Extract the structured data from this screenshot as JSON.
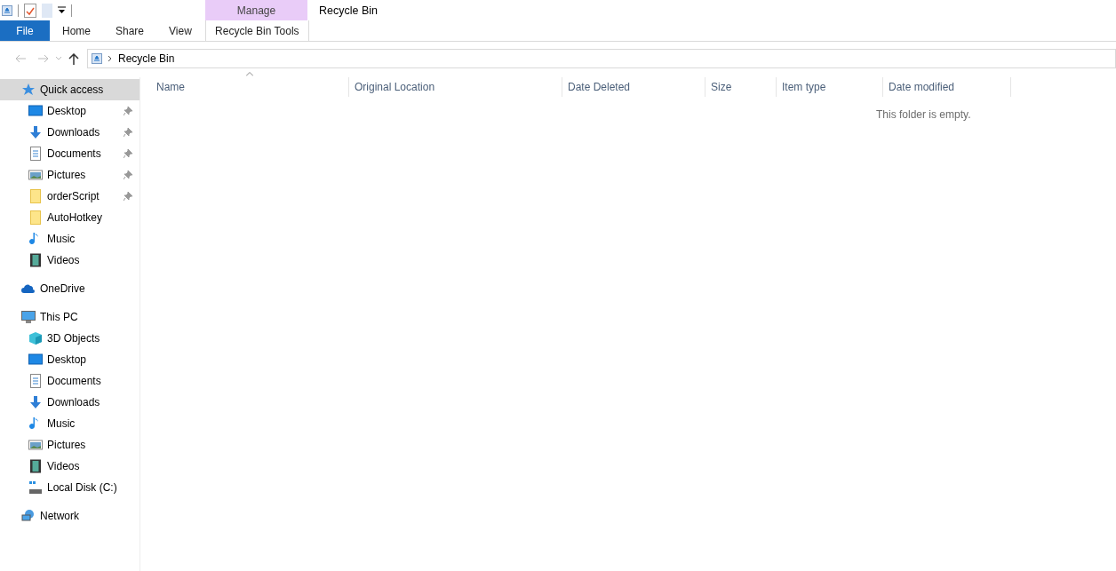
{
  "window": {
    "title": "Recycle Bin"
  },
  "context_group": "Manage",
  "ribbon_tabs": [
    {
      "label": "File",
      "kind": "file"
    },
    {
      "label": "Home",
      "kind": "tab"
    },
    {
      "label": "Share",
      "kind": "tab"
    },
    {
      "label": "View",
      "kind": "tab"
    },
    {
      "label": "Recycle Bin Tools",
      "kind": "context"
    }
  ],
  "address": {
    "path": "Recycle Bin"
  },
  "sidebar": {
    "items": [
      {
        "label": "Quick access",
        "kind": "star",
        "selected": true,
        "children": [
          {
            "label": "Desktop",
            "kind": "desktop",
            "pinned": true
          },
          {
            "label": "Downloads",
            "kind": "download",
            "pinned": true
          },
          {
            "label": "Documents",
            "kind": "document",
            "pinned": true
          },
          {
            "label": "Pictures",
            "kind": "picture",
            "pinned": true
          },
          {
            "label": "orderScript",
            "kind": "folder",
            "pinned": true
          },
          {
            "label": "AutoHotkey",
            "kind": "folder",
            "pinned": false
          },
          {
            "label": "Music",
            "kind": "music",
            "pinned": false
          },
          {
            "label": "Videos",
            "kind": "video",
            "pinned": false
          }
        ]
      },
      {
        "label": "OneDrive",
        "kind": "cloud",
        "selected": false
      },
      {
        "label": "This PC",
        "kind": "pc",
        "selected": false,
        "children": [
          {
            "label": "3D Objects",
            "kind": "cube",
            "pinned": false
          },
          {
            "label": "Desktop",
            "kind": "desktop",
            "pinned": false
          },
          {
            "label": "Documents",
            "kind": "document",
            "pinned": false
          },
          {
            "label": "Downloads",
            "kind": "download",
            "pinned": false
          },
          {
            "label": "Music",
            "kind": "music",
            "pinned": false
          },
          {
            "label": "Pictures",
            "kind": "picture",
            "pinned": false
          },
          {
            "label": "Videos",
            "kind": "video",
            "pinned": false
          },
          {
            "label": "Local Disk (C:)",
            "kind": "disk",
            "pinned": false
          }
        ]
      },
      {
        "label": "Network",
        "kind": "network",
        "selected": false
      }
    ]
  },
  "table": {
    "columns": [
      {
        "label": "Name",
        "sorted": true
      },
      {
        "label": "Original Location",
        "sorted": false
      },
      {
        "label": "Date Deleted",
        "sorted": false
      },
      {
        "label": "Size",
        "sorted": false
      },
      {
        "label": "Item type",
        "sorted": false
      },
      {
        "label": "Date modified",
        "sorted": false
      }
    ],
    "empty_message": "This folder is empty."
  }
}
